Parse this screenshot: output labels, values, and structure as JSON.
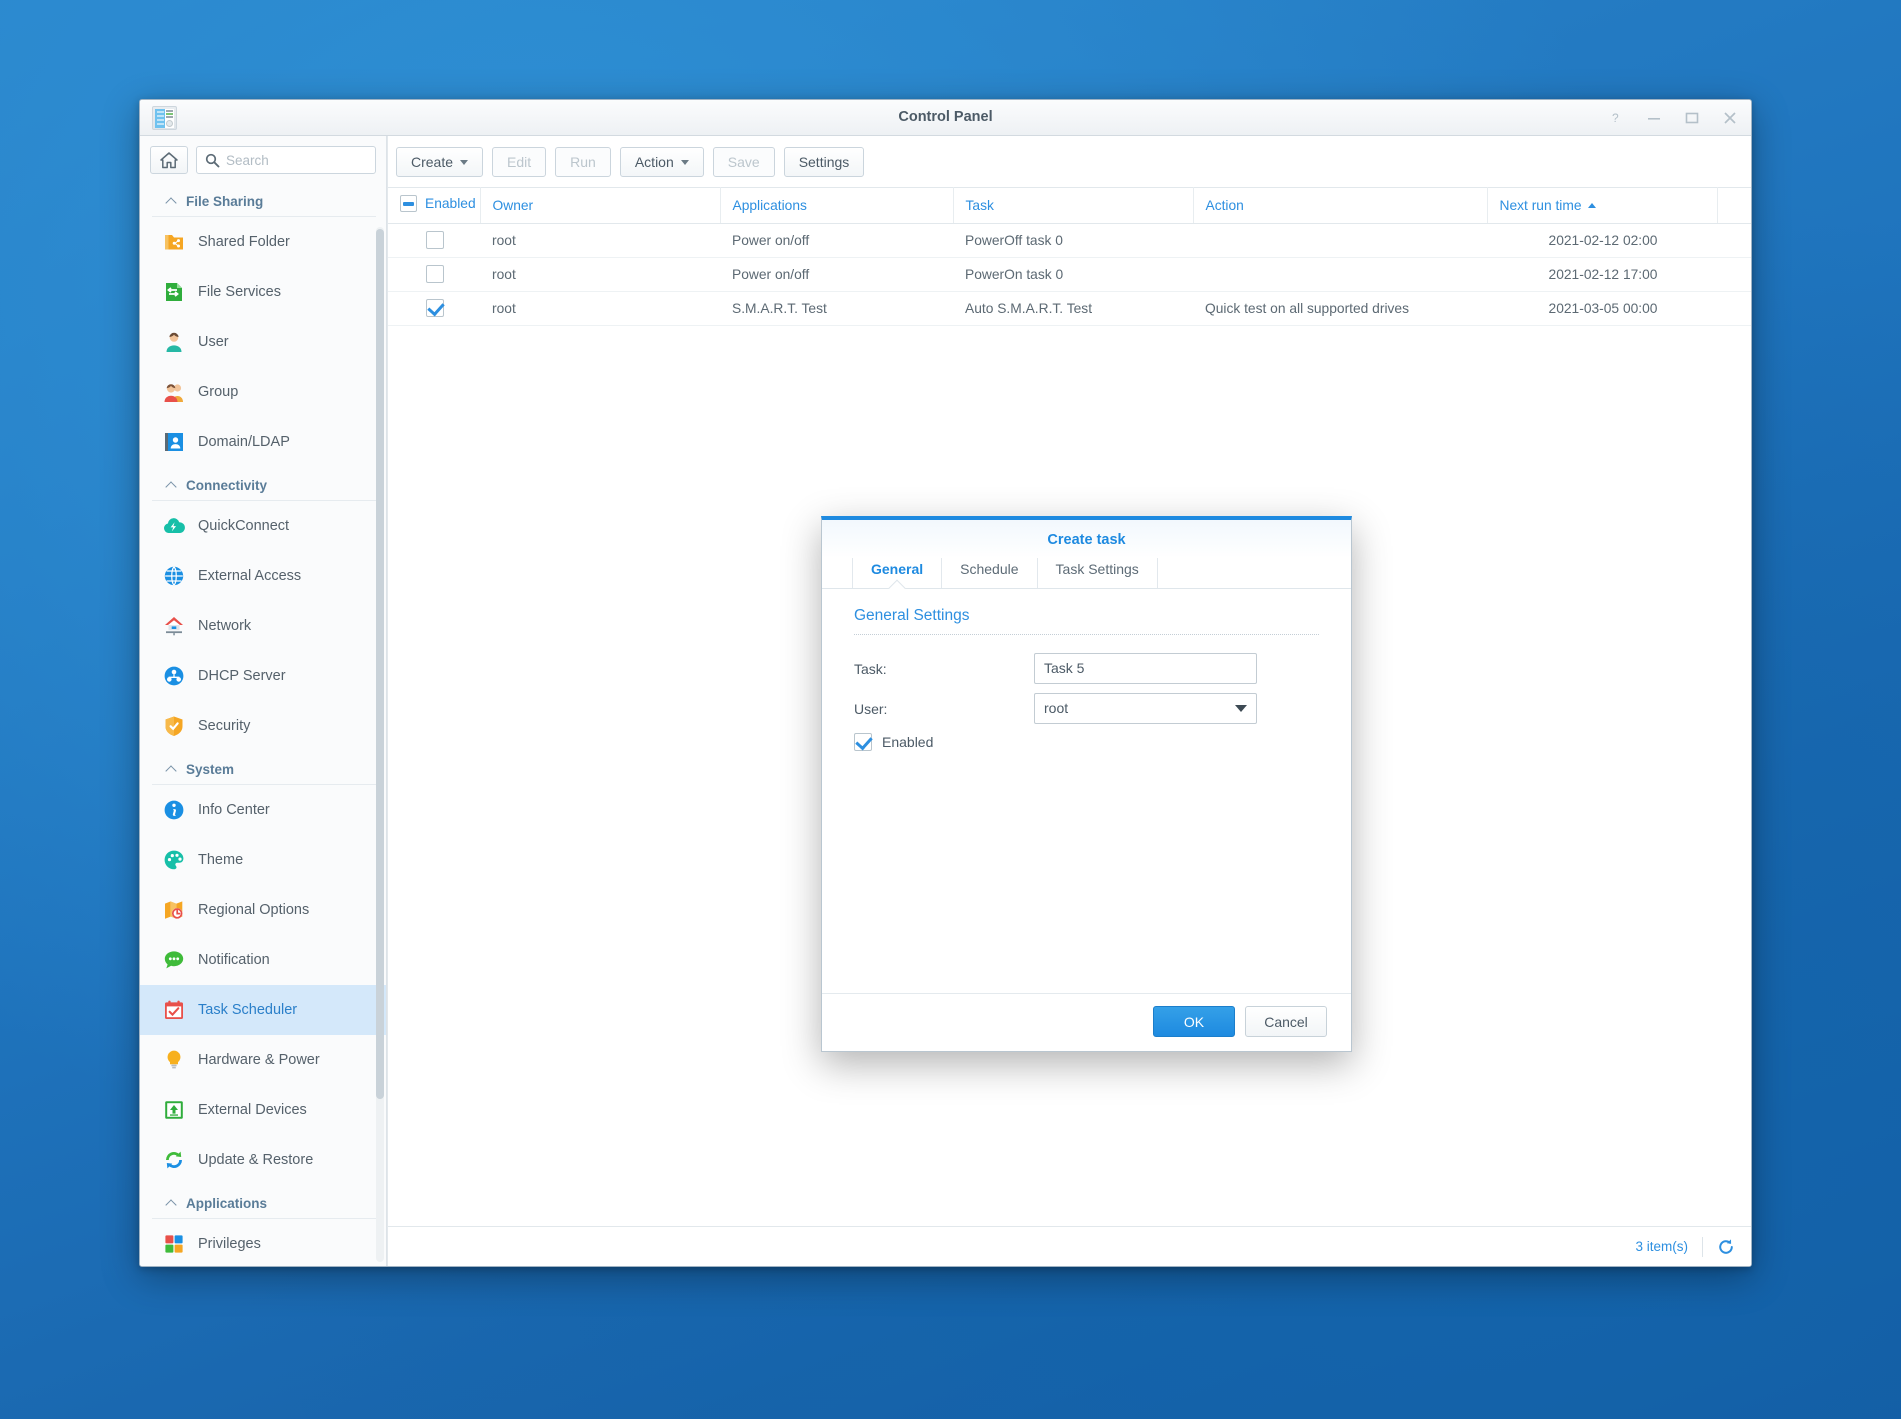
{
  "window": {
    "title": "Control Panel",
    "app_icon": "control-panel-icon",
    "controls": [
      {
        "name": "help-button",
        "glyph": "?"
      },
      {
        "name": "minimize-button",
        "glyph": "—"
      },
      {
        "name": "maximize-button",
        "glyph": "□"
      },
      {
        "name": "close-button",
        "glyph": "✕"
      }
    ]
  },
  "sidebar": {
    "home_icon": "home-icon",
    "search": {
      "placeholder": "Search",
      "value": "",
      "icon": "search-icon"
    },
    "groups": [
      {
        "label": "File Sharing",
        "items": [
          {
            "label": "Shared Folder",
            "icon": "shared-folder-icon"
          },
          {
            "label": "File Services",
            "icon": "file-services-icon"
          },
          {
            "label": "User",
            "icon": "user-icon"
          },
          {
            "label": "Group",
            "icon": "group-icon"
          },
          {
            "label": "Domain/LDAP",
            "icon": "domain-ldap-icon"
          }
        ]
      },
      {
        "label": "Connectivity",
        "items": [
          {
            "label": "QuickConnect",
            "icon": "quickconnect-icon"
          },
          {
            "label": "External Access",
            "icon": "external-access-icon"
          },
          {
            "label": "Network",
            "icon": "network-icon"
          },
          {
            "label": "DHCP Server",
            "icon": "dhcp-server-icon"
          },
          {
            "label": "Security",
            "icon": "security-shield-icon"
          }
        ]
      },
      {
        "label": "System",
        "items": [
          {
            "label": "Info Center",
            "icon": "info-center-icon"
          },
          {
            "label": "Theme",
            "icon": "theme-palette-icon"
          },
          {
            "label": "Regional Options",
            "icon": "regional-options-icon"
          },
          {
            "label": "Notification",
            "icon": "notification-icon"
          },
          {
            "label": "Task Scheduler",
            "icon": "task-scheduler-icon",
            "active": true
          },
          {
            "label": "Hardware & Power",
            "icon": "hardware-power-icon"
          },
          {
            "label": "External Devices",
            "icon": "external-devices-icon"
          },
          {
            "label": "Update & Restore",
            "icon": "update-restore-icon"
          }
        ]
      },
      {
        "label": "Applications",
        "items": [
          {
            "label": "Privileges",
            "icon": "privileges-icon"
          }
        ]
      }
    ]
  },
  "toolbar": {
    "create_label": "Create",
    "edit_label": "Edit",
    "run_label": "Run",
    "action_label": "Action",
    "save_label": "Save",
    "settings_label": "Settings"
  },
  "table": {
    "columns": [
      "Enabled",
      "Owner",
      "Applications",
      "Task",
      "Action",
      "Next run time"
    ],
    "sorted_column": "Next run time",
    "sort_direction": "asc",
    "rows": [
      {
        "enabled": false,
        "owner": "root",
        "applications": "Power on/off",
        "task": "PowerOff task 0",
        "action": "",
        "next_run_time": "2021-02-12 02:00"
      },
      {
        "enabled": false,
        "owner": "root",
        "applications": "Power on/off",
        "task": "PowerOn task 0",
        "action": "",
        "next_run_time": "2021-02-12 17:00"
      },
      {
        "enabled": true,
        "owner": "root",
        "applications": "S.M.A.R.T. Test",
        "task": "Auto S.M.A.R.T. Test",
        "action": "Quick test on all supported drives",
        "next_run_time": "2021-03-05 00:00"
      }
    ]
  },
  "statusbar": {
    "item_count": "3 item(s)",
    "refresh_icon": "refresh-icon"
  },
  "dialog": {
    "title": "Create task",
    "tabs": [
      {
        "label": "General",
        "selected": true
      },
      {
        "label": "Schedule",
        "selected": false
      },
      {
        "label": "Task Settings",
        "selected": false
      }
    ],
    "section_title": "General Settings",
    "fields": {
      "task_label": "Task:",
      "task_value": "Task 5",
      "user_label": "User:",
      "user_value": "root",
      "enabled_label": "Enabled",
      "enabled_checked": true
    },
    "ok_label": "OK",
    "cancel_label": "Cancel"
  },
  "colors": {
    "accent": "#2d8fe0",
    "primary_button": "#1e8ae0",
    "desktop": "#1f74bd",
    "active_sidebar": "#d4e8fa"
  }
}
